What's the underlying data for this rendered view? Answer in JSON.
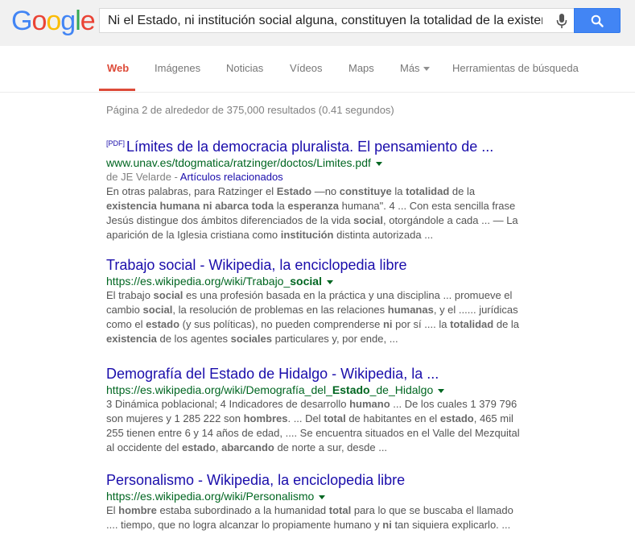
{
  "search": {
    "query": "Ni el Estado, ni institución social alguna, constituyen la totalidad de la existencia humana"
  },
  "tabs": [
    {
      "label": "Web",
      "active": true
    },
    {
      "label": "Imágenes"
    },
    {
      "label": "Noticias"
    },
    {
      "label": "Vídeos"
    },
    {
      "label": "Maps"
    },
    {
      "label": "Más"
    },
    {
      "label": "Herramientas de búsqueda"
    }
  ],
  "stats": "Página 2 de alrededor de 375,000 resultados (0.41 segundos)",
  "results": [
    {
      "pdf_tag": "[PDF]",
      "title": "Límites de la democracia pluralista. El pensamiento de ...",
      "url": "www.unav.es/tdogmatica/ratzinger/doctos/Limites.pdf",
      "author": "de JE Velarde - ",
      "related": "Artículos relacionados",
      "snippet": "En otras palabras, para Ratzinger el <b>Estado</b> —no <b>constituye</b> la <b>totalidad</b> de la <b>existencia humana ni abarca toda</b> la <b>esperanza</b> humana\". 4 ... Con esta sencilla frase Jesús distingue dos ámbitos diferenciados de la vida <b>social</b>, otorgándole a cada ... — La aparición de la Iglesia cristiana como <b>institución</b> distinta autorizada ..."
    },
    {
      "title": "Trabajo social - Wikipedia, la enciclopedia libre",
      "url": "https://es.wikipedia.org/wiki/Trabajo_<b>social</b>",
      "snippet": "El trabajo <b>social</b> es una profesión basada en la práctica y una disciplina ... promueve el cambio <b>social</b>, la resolución de problemas en las relaciones <b>humanas</b>, y el ...... jurídicas como el <b>estado</b> (y sus políticas), no pueden comprenderse <b>ni</b> por sí .... la <b>totalidad</b> de la <b>existencia</b> de los agentes <b>sociales</b> particulares y, por ende, ..."
    },
    {
      "title": "Demografía del Estado de Hidalgo - Wikipedia, la ...",
      "url": "https://es.wikipedia.org/wiki/Demografía_del_<b>Estado</b>_de_Hidalgo",
      "snippet": "3 Dinámica poblacional; 4 Indicadores de desarrollo <b>humano</b> ... De los cuales 1 379 796 son mujeres y 1 285 222 son <b>hombres</b>. ... Del <b>total</b> de habitantes en el <b>estado</b>, 465 mil 255 tienen entre 6 y 14 años de edad, .... Se encuentra situados en el Valle del Mezquital al occidente del <b>estado</b>, <b>abarcando</b> de norte a sur, desde ..."
    },
    {
      "title": "Personalismo - Wikipedia, la enciclopedia libre",
      "url": "https://es.wikipedia.org/wiki/Personalismo",
      "snippet": "El <b>hombre</b> estaba subordinado a la humanidad <b>total</b> para lo que se buscaba el llamado .... tiempo, que no logra alcanzar lo propiamente humano y <b>ni</b> tan siquiera explicarlo. ..."
    }
  ]
}
